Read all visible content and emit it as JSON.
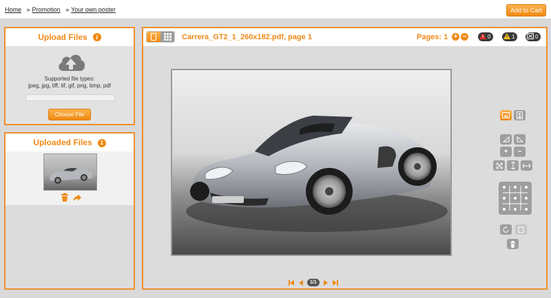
{
  "breadcrumb": {
    "home": "Home",
    "promotion": "Promotion",
    "current": "Your own poster",
    "separator": "»"
  },
  "header": {
    "add_to_cart": "Add to Cart"
  },
  "upload_panel": {
    "title": "Upload Files",
    "info_icon": "i",
    "supported_line1": "Supported file types:",
    "supported_line2": "jpeg, jpg, tiff, tif, gif, png, bmp, pdf",
    "choose_file": "Choose File"
  },
  "uploaded_panel": {
    "title": "Uploaded Files",
    "count": "1"
  },
  "main": {
    "document_title": "Carrera_GT2_1_260x182.pdf, page 1",
    "pages_label": "Pages: 1",
    "add_page": "+",
    "remove_page": "−",
    "status": {
      "errors": "0",
      "warnings": "1",
      "other": "0"
    },
    "pager_count": "1/1"
  },
  "colors": {
    "accent": "#f08a17",
    "panel_border": "#f0902a",
    "tool_gray": "#9e9e9e"
  },
  "icons": [
    "upload-cloud-icon",
    "info-icon",
    "trash-icon",
    "share-arrow-icon",
    "single-page-icon",
    "grid-view-icon",
    "error-icon",
    "warning-icon",
    "ignore-icon",
    "landscape-icon",
    "portrait-icon",
    "rotate-icon",
    "first-page-icon",
    "prev-page-icon",
    "next-page-icon",
    "last-page-icon"
  ]
}
